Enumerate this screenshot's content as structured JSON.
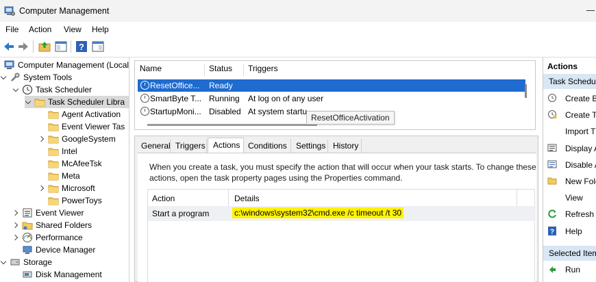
{
  "window": {
    "title": "Computer Management"
  },
  "menu": [
    "File",
    "Action",
    "View",
    "Help"
  ],
  "tree": [
    {
      "label": "Computer Management (Local",
      "level": 0,
      "chev": "none",
      "icon": "computer-icon"
    },
    {
      "label": "System Tools",
      "level": 1,
      "chev": "down",
      "icon": "tools-icon"
    },
    {
      "label": "Task Scheduler",
      "level": 2,
      "chev": "down",
      "icon": "clock-icon"
    },
    {
      "label": "Task Scheduler Libra",
      "level": 3,
      "chev": "down",
      "icon": "folder-icon",
      "selected": true
    },
    {
      "label": "Agent Activation",
      "level": 4,
      "chev": "none",
      "icon": "folder-icon"
    },
    {
      "label": "Event Viewer Tas",
      "level": 4,
      "chev": "none",
      "icon": "folder-icon"
    },
    {
      "label": "GoogleSystem",
      "level": 4,
      "chev": "right",
      "icon": "folder-icon"
    },
    {
      "label": "Intel",
      "level": 4,
      "chev": "none",
      "icon": "folder-icon"
    },
    {
      "label": "McAfeeTsk",
      "level": 4,
      "chev": "none",
      "icon": "folder-icon"
    },
    {
      "label": "Meta",
      "level": 4,
      "chev": "none",
      "icon": "folder-icon"
    },
    {
      "label": "Microsoft",
      "level": 4,
      "chev": "right",
      "icon": "folder-icon"
    },
    {
      "label": "PowerToys",
      "level": 4,
      "chev": "none",
      "icon": "folder-icon"
    },
    {
      "label": "Event Viewer",
      "level": 2,
      "chev": "right",
      "icon": "event-viewer-icon"
    },
    {
      "label": "Shared Folders",
      "level": 2,
      "chev": "right",
      "icon": "shared-folder-icon"
    },
    {
      "label": "Performance",
      "level": 2,
      "chev": "right",
      "icon": "performance-icon"
    },
    {
      "label": "Device Manager",
      "level": 2,
      "chev": "none",
      "icon": "device-manager-icon"
    },
    {
      "label": "Storage",
      "level": 1,
      "chev": "down",
      "icon": "storage-icon"
    },
    {
      "label": "Disk Management",
      "level": 2,
      "chev": "none",
      "icon": "disk-icon"
    }
  ],
  "tasklist": {
    "columns": [
      "Name",
      "Status",
      "Triggers"
    ],
    "rows": [
      {
        "name": "ResetOffice...",
        "status": "Ready",
        "triggers": "",
        "selected": true
      },
      {
        "name": "SmartByte T...",
        "status": "Running",
        "triggers": "At log on of any user"
      },
      {
        "name": "StartupMoni...",
        "status": "Disabled",
        "triggers": "At system startu"
      }
    ],
    "tooltip": "ResetOfficeActivation"
  },
  "tabs": [
    "General",
    "Triggers",
    "Actions",
    "Conditions",
    "Settings",
    "History"
  ],
  "active_tab": "Actions",
  "actions_tab": {
    "description": "When you create a task, you must specify the action that will occur when your task starts.  To change these actions, open the task property pages using the Properties command.",
    "columns": [
      "Action",
      "Details"
    ],
    "rows": [
      {
        "action": "Start a program",
        "details": "c:\\windows\\system32\\cmd.exe /c timeout /t 30"
      }
    ]
  },
  "actions_pane": {
    "header": "Actions",
    "section1": "Task Schedule",
    "items1": [
      {
        "label": "Create Ba",
        "icon": "create-basic-task-icon"
      },
      {
        "label": "Create Ta",
        "icon": "create-task-icon"
      },
      {
        "label": "Import T",
        "icon": ""
      },
      {
        "label": "Display A",
        "icon": "display-running-icon"
      },
      {
        "label": "Disable A",
        "icon": "disable-history-icon"
      },
      {
        "label": "New Fold",
        "icon": "new-folder-icon"
      },
      {
        "label": "View",
        "icon": ""
      },
      {
        "label": "Refresh",
        "icon": "refresh-icon"
      },
      {
        "label": "Help",
        "icon": "help-icon"
      }
    ],
    "section2": "Selected Item",
    "items2": [
      {
        "label": "Run",
        "icon": "run-icon"
      }
    ]
  }
}
